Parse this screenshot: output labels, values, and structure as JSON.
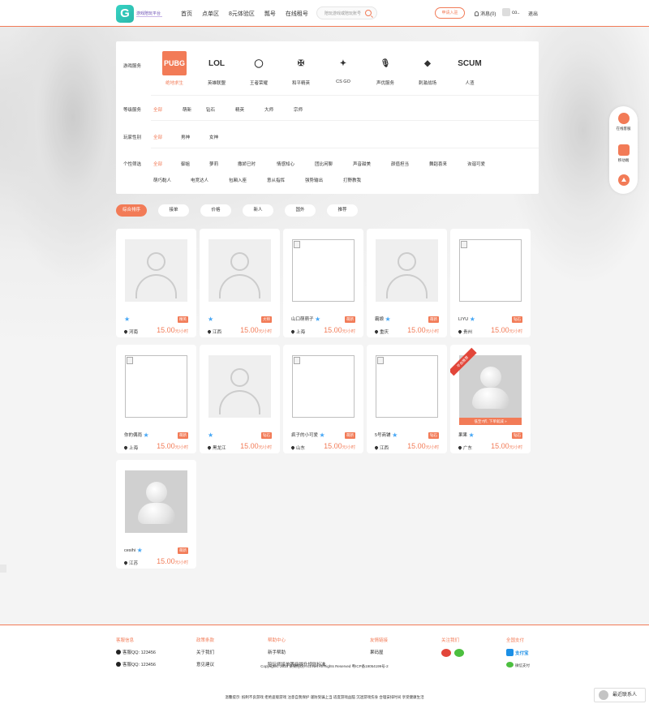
{
  "header": {
    "logo_text": "游戏陪玩平台",
    "nav": [
      "首页",
      "点单区",
      "8元体验区",
      "瓢号",
      "在线租号"
    ],
    "search_placeholder": "陪玩游戏或陪玩账号",
    "join_label": "申请入驻",
    "messages_label": "消息(0)",
    "user_label": "co..",
    "logout_label": "退出"
  },
  "filter": {
    "game_label": "游戏服务",
    "games": [
      {
        "icon": "PUBG",
        "label": "绝地求生"
      },
      {
        "icon": "LOL",
        "label": "英雄联盟"
      },
      {
        "icon": "◯",
        "label": "王者荣耀"
      },
      {
        "icon": "✠",
        "label": "和平精英"
      },
      {
        "icon": "✦",
        "label": "CS GO"
      },
      {
        "icon": "🎙",
        "label": "声优服务"
      },
      {
        "icon": "◆",
        "label": "刺激战场"
      },
      {
        "icon": "SCUM",
        "label": "人渣"
      }
    ],
    "rank_label": "等级服务",
    "ranks": [
      "全部",
      "萌新",
      "钻石",
      "精英",
      "大师",
      "宗师"
    ],
    "gender_label": "玩家性别",
    "genders": [
      "全部",
      "男神",
      "女神"
    ],
    "custom_label": "个性筛选",
    "customs": [
      "全部",
      "御姐",
      "萝莉",
      "撒娇已时",
      "情感知心",
      "团比闲聊",
      "声音甜美",
      "颜值担当",
      "舞蹈喜来",
      "诙谐可爱",
      "萌巧黏人",
      "电竞达人",
      "包厢入座",
      "意从指挥",
      "强势输出",
      "打野教我"
    ]
  },
  "tabs": [
    "综合排序",
    "接单",
    "价格",
    "新人",
    "国外",
    "推荐"
  ],
  "cards": [
    {
      "name": "",
      "badge": "精英",
      "loc": "河南",
      "price": "15.00",
      "unit": "元/小时",
      "photo": "placeholder"
    },
    {
      "name": "",
      "badge": "大师",
      "loc": "江西",
      "price": "15.00",
      "unit": "元/小时",
      "photo": "placeholder"
    },
    {
      "name": "山口萌萌子",
      "badge": "萌新",
      "loc": "上海",
      "price": "15.00",
      "unit": "元/小时",
      "photo": "broken"
    },
    {
      "name": "霸娘",
      "badge": "萌新",
      "loc": "重庆",
      "price": "15.00",
      "unit": "元/小时",
      "photo": "placeholder"
    },
    {
      "name": "LIYU",
      "badge": "钻石",
      "loc": "贵州",
      "price": "15.00",
      "unit": "元/小时",
      "photo": "broken"
    },
    {
      "name": "你的偶雨",
      "badge": "萌新",
      "loc": "上海",
      "price": "15.00",
      "unit": "元/小时",
      "photo": "broken"
    },
    {
      "name": "",
      "badge": "钻石",
      "loc": "黑龙江",
      "price": "15.00",
      "unit": "元/小时",
      "photo": "placeholder"
    },
    {
      "name": "疯子的小可爱",
      "badge": "萌新",
      "loc": "山东",
      "price": "15.00",
      "unit": "元/小时",
      "photo": "broken"
    },
    {
      "name": "5号商铺",
      "badge": "钻石",
      "loc": "江西",
      "price": "15.00",
      "unit": "元/小时",
      "photo": "broken"
    },
    {
      "name": "果果",
      "badge": "钻石",
      "loc": "广东",
      "price": "15.00",
      "unit": "元/小时",
      "photo": "grey",
      "ribbon": "平台推荐",
      "promo": "低至7折, 下单就减 »"
    },
    {
      "name": "cesihi",
      "badge": "萌新",
      "loc": "江苏",
      "price": "15.00",
      "unit": "元/小时",
      "photo": "grey"
    }
  ],
  "float": [
    "在线客服",
    "移动端",
    ""
  ],
  "footer": {
    "cols": [
      {
        "head": "客服信息",
        "links": [
          "客服QQ: 123456",
          "客服QQ: 123456"
        ]
      },
      {
        "head": "政策条款",
        "links": [
          "关于我们",
          "意见建议"
        ]
      },
      {
        "head": "帮助中心",
        "links": [
          "新手帮助",
          "陪玩师接单等级提升规则标准"
        ]
      },
      {
        "head": "友情链接",
        "links": [
          "果码屋"
        ]
      },
      {
        "head": "关注我们",
        "links": []
      },
      {
        "head": "全国支付",
        "links": [
          "支付宝",
          "微信支付"
        ]
      }
    ],
    "copyright": "Copyright© 2019 果果陪玩Yrc1.Net All Rights Reserved 粤ICP备19054199号-2",
    "notice": "温馨提示: 抵制不良游戏 拒绝盗版游戏 注意自我保护 谨防受骗上当 适度游戏益脑 沉迷游戏伤身 合理安排时间 享受健康生活",
    "contact_label": "最近联系人"
  },
  "colors": {
    "accent": "#f27b57",
    "star": "#46a7f5"
  }
}
